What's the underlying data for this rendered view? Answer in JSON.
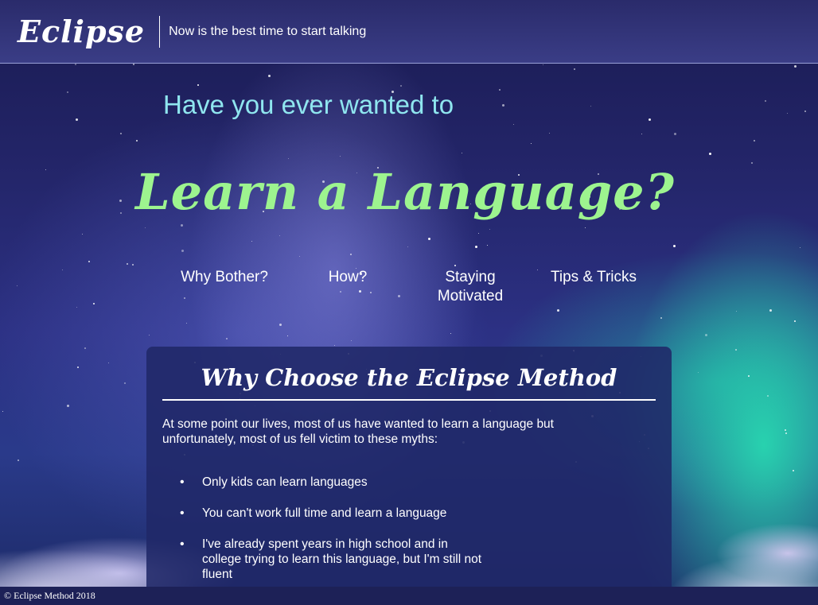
{
  "header": {
    "logo": "Eclipse",
    "tagline": "Now is the best time to start talking"
  },
  "hero": {
    "subtitle": "Have you ever wanted to",
    "title": "Learn a Language?"
  },
  "nav": {
    "items": [
      {
        "label": "Why Bother?"
      },
      {
        "label": "How?"
      },
      {
        "label": "Staying Motivated"
      },
      {
        "label": "Tips & Tricks"
      }
    ]
  },
  "card": {
    "title": "Why Choose the Eclipse Method",
    "intro": "At some point our lives, most of us have wanted to learn a language but unfortunately, most of us fell victim to these myths:",
    "myths": [
      "Only kids can learn languages",
      "You can't work full time and learn a language",
      "I've already spent years in high school and in college trying to learn this language, but I'm still not fluent"
    ]
  },
  "footer": {
    "copyright": "© Eclipse Method 2018"
  },
  "colors": {
    "header_bg": "#2a2b6b",
    "subtitle": "#8fe6ef",
    "title": "#9df48f",
    "card_bg": "#202868",
    "footer_bg": "#1d2157"
  }
}
